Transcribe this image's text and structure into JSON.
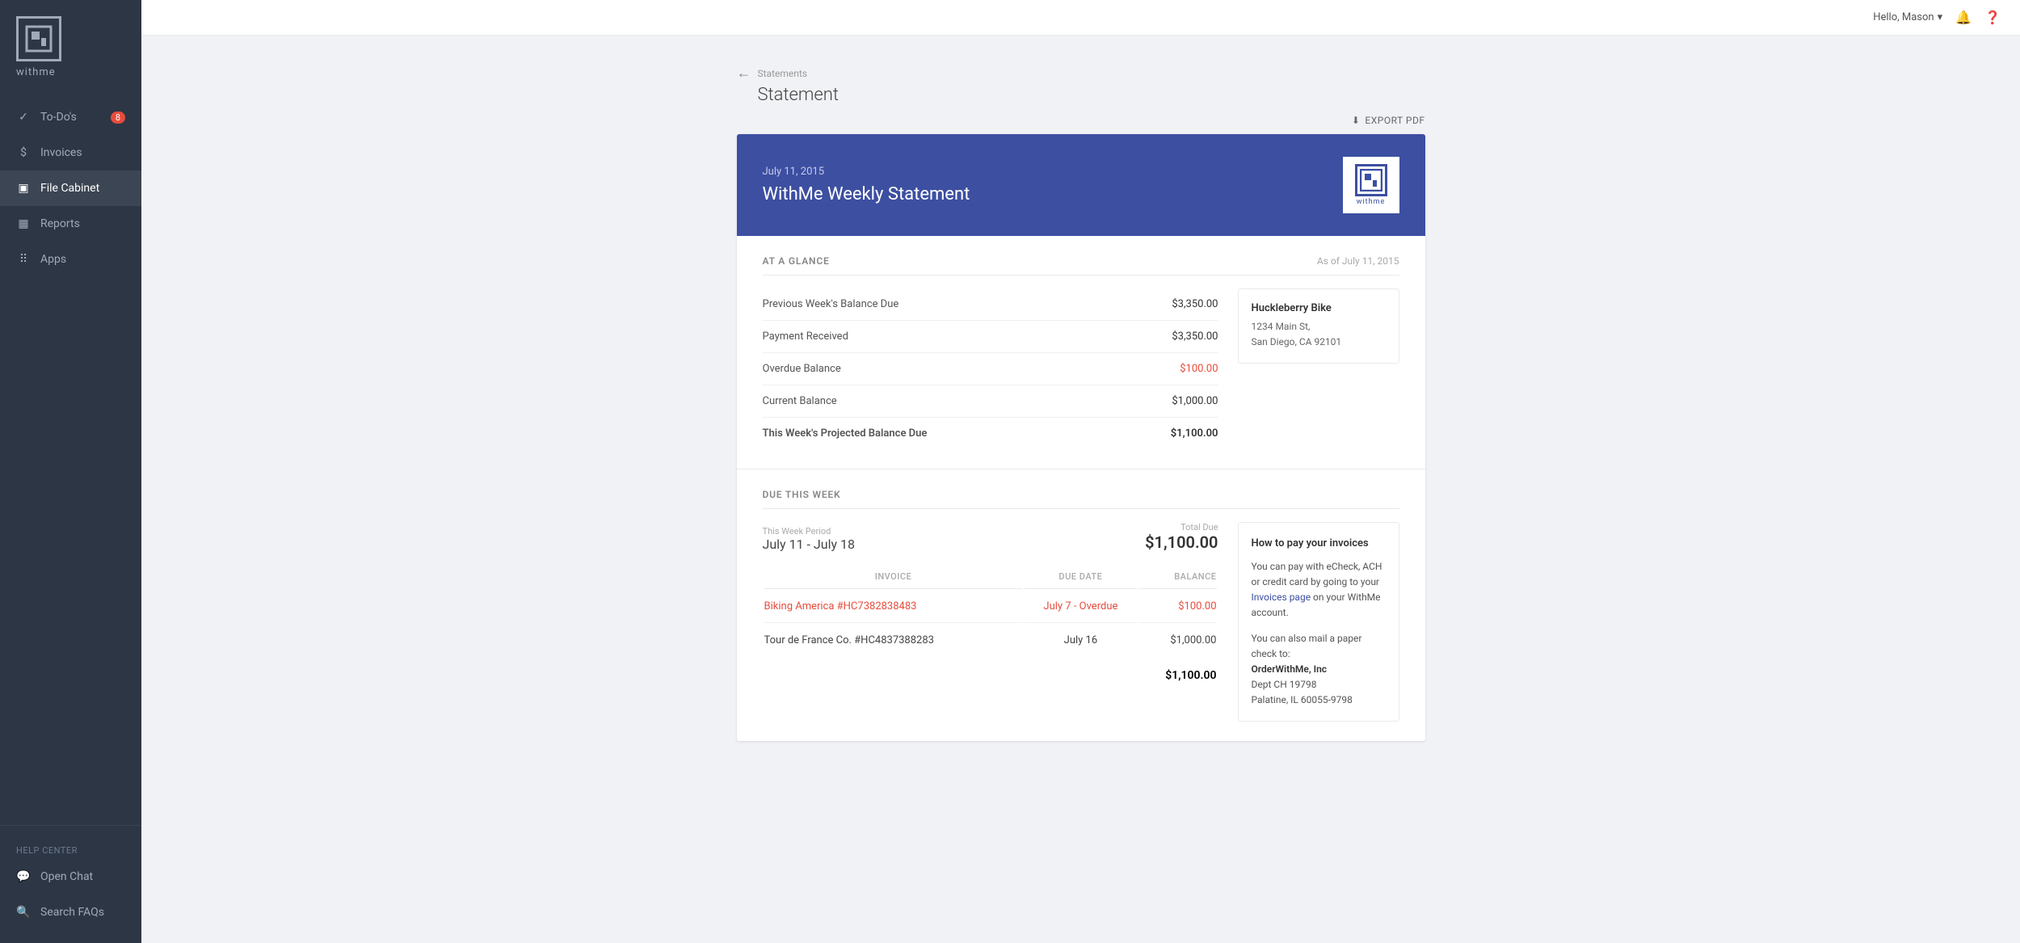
{
  "sidebar": {
    "logo_text": "withme",
    "nav_items": [
      {
        "id": "todos",
        "label": "To-Do's",
        "badge": "8",
        "active": false
      },
      {
        "id": "invoices",
        "label": "Invoices",
        "badge": null,
        "active": false
      },
      {
        "id": "file-cabinet",
        "label": "File Cabinet",
        "badge": null,
        "active": true
      },
      {
        "id": "reports",
        "label": "Reports",
        "badge": null,
        "active": false
      },
      {
        "id": "apps",
        "label": "Apps",
        "badge": null,
        "active": false
      }
    ],
    "help_center": "Help Center",
    "open_chat": "Open Chat",
    "search_faqs": "Search FAQs"
  },
  "topbar": {
    "user_greeting": "Hello, Mason",
    "chevron": "▾"
  },
  "page": {
    "breadcrumb_parent": "Statements",
    "page_title": "Statement",
    "export_label": "EXPORT PDF"
  },
  "statement": {
    "date": "July 11, 2015",
    "title": "WithMe Weekly Statement",
    "logo_brand": "withme",
    "at_a_glance": {
      "section_title": "AT A GLANCE",
      "as_of": "As of July 11, 2015",
      "rows": [
        {
          "label": "Previous Week's Balance Due",
          "value": "$3,350.00",
          "overdue": false,
          "bold": false
        },
        {
          "label": "Payment Received",
          "value": "$3,350.00",
          "overdue": false,
          "bold": false
        },
        {
          "label": "Overdue Balance",
          "value": "$100.00",
          "overdue": true,
          "bold": false
        },
        {
          "label": "Current Balance",
          "value": "$1,000.00",
          "overdue": false,
          "bold": false
        },
        {
          "label": "This Week's Projected Balance Due",
          "value": "$1,100.00",
          "overdue": false,
          "bold": true
        }
      ],
      "address": {
        "company": "Huckleberry Bike",
        "line1": "1234 Main St,",
        "line2": "San Diego, CA 92101"
      }
    },
    "due_this_week": {
      "section_title": "DUE THIS WEEK",
      "period_label": "This Week Period",
      "period_dates": "July 11 - July 18",
      "total_due_label": "Total Due",
      "total_due_amount": "$1,100.00",
      "table_headers": [
        "INVOICE",
        "DUE DATE",
        "BALANCE"
      ],
      "invoices": [
        {
          "id": "inv1",
          "name": "Biking America #HC7382838483",
          "link": true,
          "due_date": "July 7 - Overdue",
          "due_overdue": true,
          "balance": "$100.00",
          "balance_overdue": true
        },
        {
          "id": "inv2",
          "name": "Tour de France Co. #HC4837388283",
          "link": false,
          "due_date": "July 16",
          "due_overdue": false,
          "balance": "$1,000.00",
          "balance_overdue": false
        }
      ],
      "total": "$1,100.00",
      "pay_info": {
        "title": "How to pay your invoices",
        "text1": "You can pay with eCheck, ACH or credit card by going to your",
        "invoices_link_text": "Invoices page",
        "text2": "on your WithMe account.",
        "mail_label": "You can also mail a paper check to:",
        "company": "OrderWithMe, Inc",
        "dept": "Dept CH 19798",
        "address": "Palatine, IL 60055-9798"
      }
    }
  }
}
